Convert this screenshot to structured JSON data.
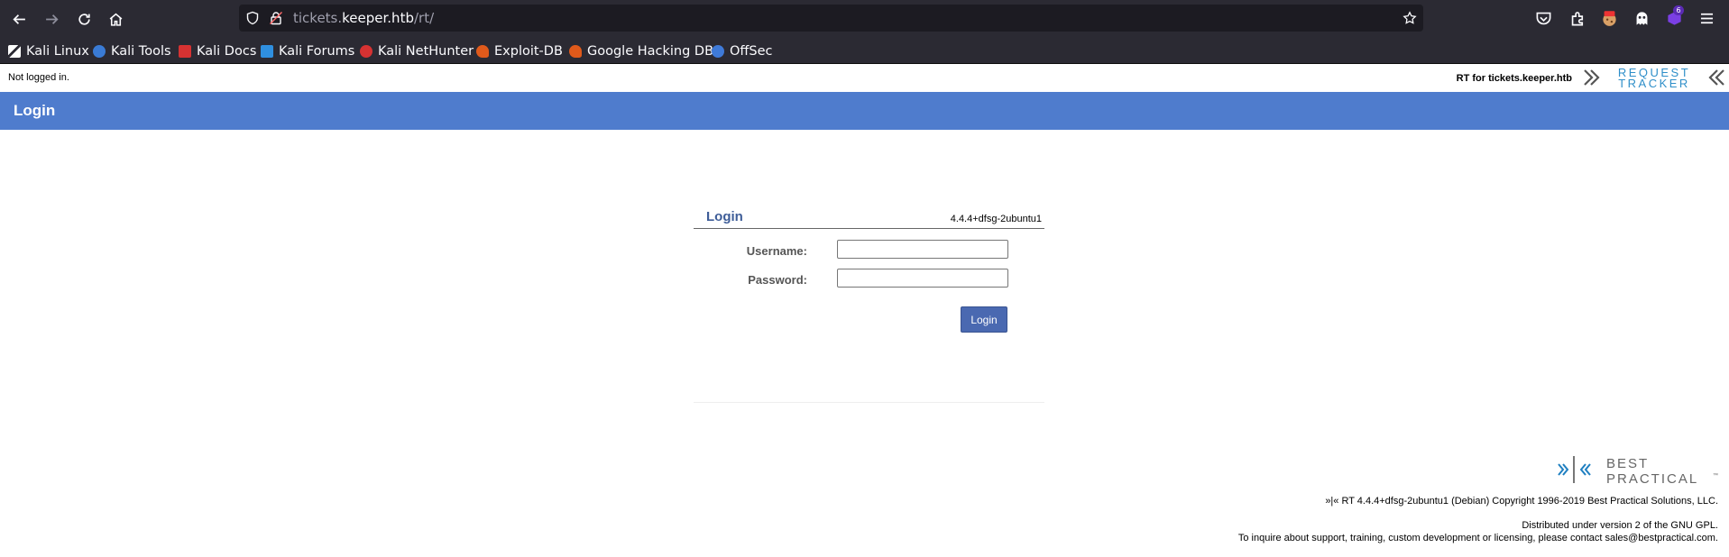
{
  "browser": {
    "url_host_prefix": "tickets.",
    "url_host_main": "keeper.htb",
    "url_path": "/rt/",
    "extension_badge": "6"
  },
  "bookmarks": [
    {
      "label": "Kali Linux",
      "icon": "kali-dragon-icon",
      "color": "#ffffff"
    },
    {
      "label": "Kali Tools",
      "icon": "kali-tools-icon",
      "color": "#3a7bd5"
    },
    {
      "label": "Kali Docs",
      "icon": "kali-docs-icon",
      "color": "#d63232"
    },
    {
      "label": "Kali Forums",
      "icon": "kali-forums-icon",
      "color": "#2f8fe0"
    },
    {
      "label": "Kali NetHunter",
      "icon": "nethunter-icon",
      "color": "#d63232"
    },
    {
      "label": "Exploit-DB",
      "icon": "exploit-db-icon",
      "color": "#e05a1b"
    },
    {
      "label": "Google Hacking DB",
      "icon": "ghdb-icon",
      "color": "#e05a1b"
    },
    {
      "label": "OffSec",
      "icon": "offsec-icon",
      "color": "#3f7ad8"
    }
  ],
  "page": {
    "login_status": "Not logged in.",
    "rt_for": "RT for tickets.keeper.htb",
    "rt_logo_top": "REQUEST",
    "rt_logo_bottom": "TRACKER",
    "header_title": "Login",
    "accent_color": "#4f7ccd"
  },
  "login_form": {
    "title": "Login",
    "version": "4.4.4+dfsg-2ubuntu1",
    "username_label": "Username:",
    "username_value": "",
    "password_label": "Password:",
    "password_value": "",
    "submit_label": "Login"
  },
  "footer": {
    "logo_top": "BEST",
    "logo_bottom": "PRACTICAL",
    "logo_tm": "™",
    "copyright": "»|« RT 4.4.4+dfsg-2ubuntu1 (Debian) Copyright 1996-2019 Best Practical Solutions, LLC.",
    "license": "Distributed under version 2 of the GNU GPL.",
    "contact": "To inquire about support, training, custom development or licensing, please contact sales@bestpractical.com."
  }
}
